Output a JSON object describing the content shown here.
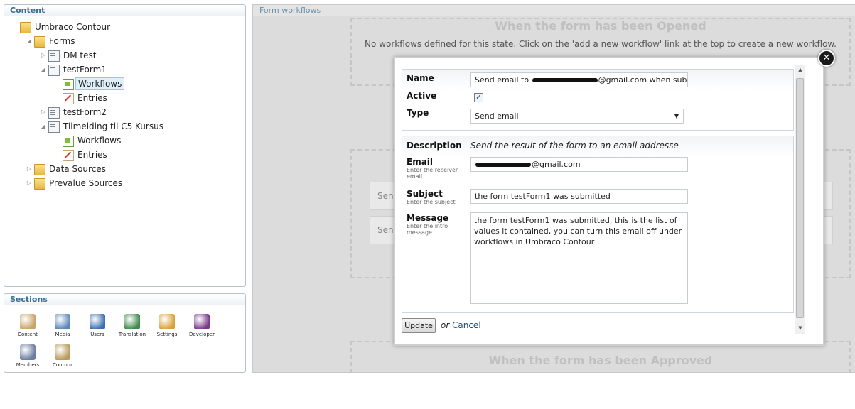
{
  "tree": {
    "header": "Content",
    "items": [
      {
        "label": "Umbraco Contour",
        "level": 0,
        "arrow": "",
        "icon": "folder"
      },
      {
        "label": "Forms",
        "level": 1,
        "arrow": "◢",
        "icon": "folder"
      },
      {
        "label": "DM test",
        "level": 2,
        "arrow": "▷",
        "icon": "doc"
      },
      {
        "label": "testForm1",
        "level": 2,
        "arrow": "◢",
        "icon": "doc"
      },
      {
        "label": "Workflows",
        "level": 3,
        "arrow": "",
        "icon": "workflow",
        "selected": true
      },
      {
        "label": "Entries",
        "level": 3,
        "arrow": "",
        "icon": "entries"
      },
      {
        "label": "testForm2",
        "level": 2,
        "arrow": "▷",
        "icon": "doc"
      },
      {
        "label": "Tilmelding til C5 Kursus",
        "level": 2,
        "arrow": "◢",
        "icon": "doc"
      },
      {
        "label": "Workflows",
        "level": 3,
        "arrow": "",
        "icon": "workflow"
      },
      {
        "label": "Entries",
        "level": 3,
        "arrow": "",
        "icon": "entries"
      },
      {
        "label": "Data Sources",
        "level": 1,
        "arrow": "▷",
        "icon": "folder"
      },
      {
        "label": "Prevalue Sources",
        "level": 1,
        "arrow": "▷",
        "icon": "folder"
      }
    ]
  },
  "sections": {
    "header": "Sections",
    "items": [
      {
        "label": "Content",
        "icon": "content-icon",
        "color": "#c9a46a"
      },
      {
        "label": "Media",
        "icon": "media-icon",
        "color": "#5b86b5"
      },
      {
        "label": "Users",
        "icon": "users-icon",
        "color": "#3d6fb0"
      },
      {
        "label": "Translation",
        "icon": "translation-icon",
        "color": "#3f8a4a"
      },
      {
        "label": "Settings",
        "icon": "settings-icon",
        "color": "#d8a23a"
      },
      {
        "label": "Developer",
        "icon": "developer-icon",
        "color": "#7a3a8a"
      },
      {
        "label": "Members",
        "icon": "members-icon",
        "color": "#6b7fa0"
      },
      {
        "label": "Contour",
        "icon": "contour-icon",
        "color": "#b89a5a"
      }
    ]
  },
  "workflows": {
    "header": "Form workflows",
    "opened_title": "When the form has been Opened",
    "no_workflows_msg": "No workflows defined for this state. Click on the 'add a new workflow' link at the top to create a new workflow.",
    "ghost_rows": [
      "Send",
      "Send"
    ],
    "approved_title": "When the form has been Approved"
  },
  "modal": {
    "name_label": "Name",
    "name_value_prefix": "Send email to ",
    "name_value_suffix": "@gmail.com when submitted",
    "active_label": "Active",
    "active_checked": "✓",
    "type_label": "Type",
    "type_value": "Send email",
    "description_label": "Description",
    "description_value": "Send the result of the form to an email addresse",
    "email_label": "Email",
    "email_sub": "Enter the receiver email",
    "email_suffix": "@gmail.com",
    "subject_label": "Subject",
    "subject_sub": "Enter the subject",
    "subject_value": "the form testForm1 was submitted",
    "message_label": "Message",
    "message_sub": "Enter the intro message",
    "message_value": "the form testForm1 was submitted, this is the list of values it contained, you can turn this email off under workflows in Umbraco Contour",
    "update_label": "Update",
    "or_label": "or",
    "cancel_label": "Cancel",
    "close_glyph": "✕"
  }
}
